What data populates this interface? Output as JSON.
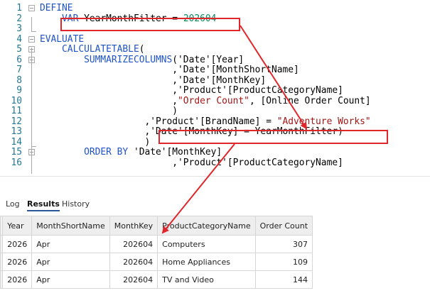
{
  "editor": {
    "lines": [
      {
        "num": "1",
        "tokens": [
          {
            "t": "DEFINE",
            "c": "kw"
          }
        ]
      },
      {
        "num": "2",
        "tokens": [
          {
            "t": "    ",
            "c": "tx"
          },
          {
            "t": "VAR",
            "c": "kw"
          },
          {
            "t": " YearMonthFilter = ",
            "c": "tx"
          },
          {
            "t": "202604",
            "c": "nm"
          }
        ]
      },
      {
        "num": "3",
        "tokens": []
      },
      {
        "num": "4",
        "tokens": [
          {
            "t": "EVALUATE",
            "c": "kw"
          }
        ]
      },
      {
        "num": "5",
        "tokens": [
          {
            "t": "    ",
            "c": "tx"
          },
          {
            "t": "CALCULATETABLE",
            "c": "kw"
          },
          {
            "t": "(",
            "c": "tx"
          }
        ]
      },
      {
        "num": "6",
        "tokens": [
          {
            "t": "        ",
            "c": "tx"
          },
          {
            "t": "SUMMARIZECOLUMNS",
            "c": "kw"
          },
          {
            "t": "('Date'[Year]",
            "c": "tx"
          }
        ]
      },
      {
        "num": "7",
        "tokens": [
          {
            "t": "                        ,'Date'[MonthShortName]",
            "c": "tx"
          }
        ]
      },
      {
        "num": "8",
        "tokens": [
          {
            "t": "                        ,'Date'[MonthKey]",
            "c": "tx"
          }
        ]
      },
      {
        "num": "9",
        "tokens": [
          {
            "t": "                        ,'Product'[ProductCategoryName]",
            "c": "tx"
          }
        ]
      },
      {
        "num": "10",
        "tokens": [
          {
            "t": "                        ,",
            "c": "tx"
          },
          {
            "t": "\"Order Count\"",
            "c": "st"
          },
          {
            "t": ", [Online Order Count]",
            "c": "tx"
          }
        ]
      },
      {
        "num": "11",
        "tokens": [
          {
            "t": "                        )",
            "c": "tx"
          }
        ]
      },
      {
        "num": "12",
        "tokens": [
          {
            "t": "                   ,'Product'[BrandName] = ",
            "c": "tx"
          },
          {
            "t": "\"Adventure Works\"",
            "c": "st"
          }
        ]
      },
      {
        "num": "13",
        "tokens": [
          {
            "t": "                   ,'Date'[MonthKey] = YearMonthFilter)",
            "c": "tx"
          }
        ]
      },
      {
        "num": "14",
        "tokens": [
          {
            "t": "                   )",
            "c": "tx"
          }
        ]
      },
      {
        "num": "15",
        "tokens": [
          {
            "t": "        ",
            "c": "tx"
          },
          {
            "t": "ORDER BY",
            "c": "kw"
          },
          {
            "t": " 'Date'[MonthKey]",
            "c": "tx"
          }
        ]
      },
      {
        "num": "16",
        "tokens": [
          {
            "t": "                        ,'Product'[ProductCategoryName]",
            "c": "tx"
          }
        ]
      }
    ]
  },
  "tabs": {
    "log": "Log",
    "results": "Results",
    "history": "History",
    "active": "results"
  },
  "results": {
    "columns": [
      "Year",
      "MonthShortName",
      "MonthKey",
      "ProductCategoryName",
      "Order Count"
    ],
    "numeric": [
      false,
      false,
      true,
      false,
      true
    ],
    "rows": [
      [
        "2026",
        "Apr",
        "202604",
        "Computers",
        "307"
      ],
      [
        "2026",
        "Apr",
        "202604",
        "Home Appliances",
        "109"
      ],
      [
        "2026",
        "Apr",
        "202604",
        "TV and Video",
        "144"
      ]
    ]
  },
  "colors": {
    "annotation": "#e0262a",
    "keyword": "#1f53c8",
    "string": "#a31515",
    "number": "#098658",
    "line_number": "#237893"
  }
}
